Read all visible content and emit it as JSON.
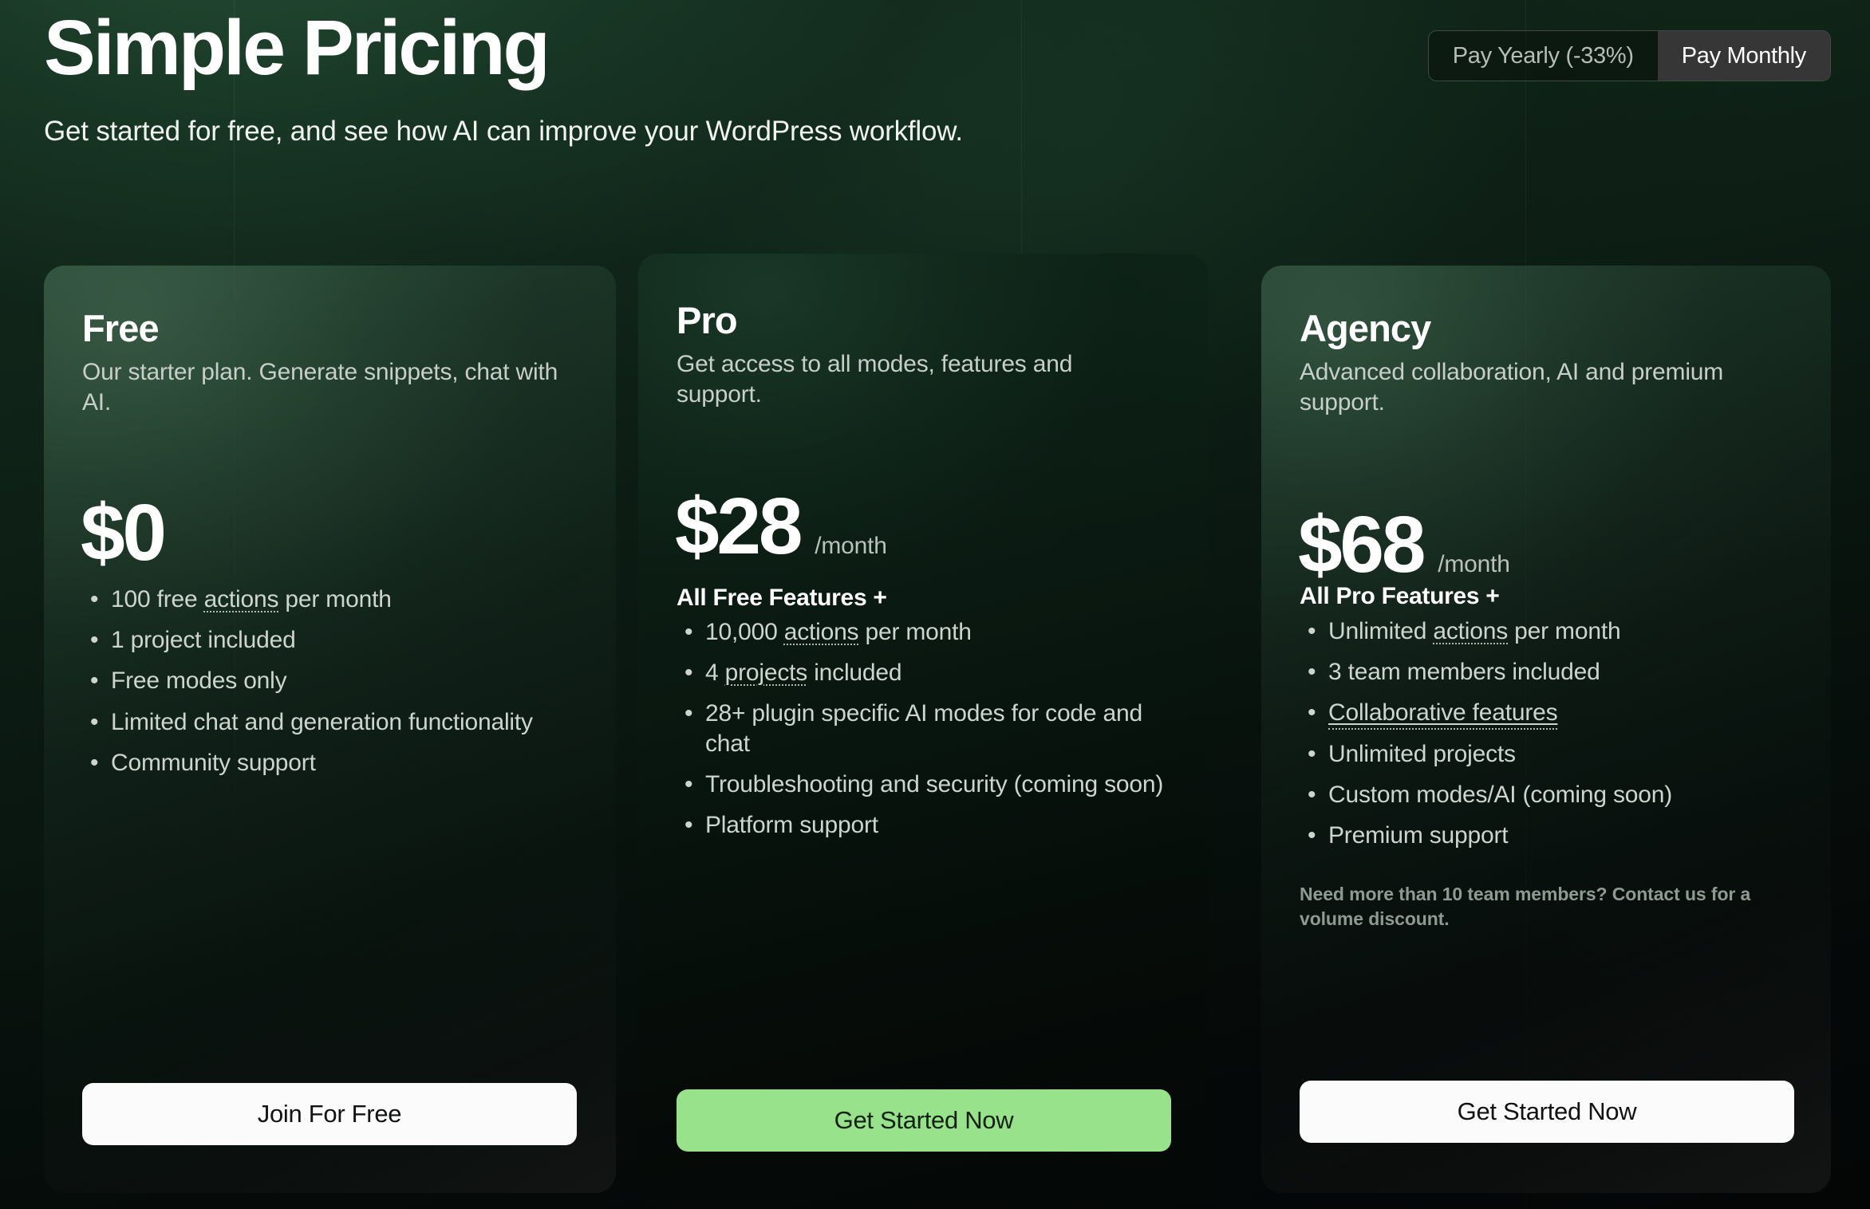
{
  "header": {
    "title": "Simple Pricing",
    "subtitle": "Get started for free, and see how AI can improve your WordPress workflow."
  },
  "billing_toggle": {
    "yearly_label": "Pay Yearly (-33%)",
    "monthly_label": "Pay Monthly",
    "selected": "Pay Monthly"
  },
  "plans": {
    "free": {
      "name": "Free",
      "description": "Our starter plan. Generate snippets, chat with AI.",
      "price": "$0",
      "period": "",
      "features_heading": "",
      "features": [
        {
          "prefix": "100 free ",
          "abbr": "actions",
          "suffix": " per month"
        },
        {
          "prefix": "1 project included",
          "abbr": "",
          "suffix": ""
        },
        {
          "prefix": "Free modes only",
          "abbr": "",
          "suffix": ""
        },
        {
          "prefix": "Limited chat and generation functionality",
          "abbr": "",
          "suffix": ""
        },
        {
          "prefix": "Community support",
          "abbr": "",
          "suffix": ""
        }
      ],
      "note": "",
      "cta_label": "Join For Free"
    },
    "pro": {
      "name": "Pro",
      "description": "Get access to all modes, features and support.",
      "price": "$28",
      "period": "/month",
      "features_heading": "All Free Features +",
      "features": [
        {
          "prefix": "10,000 ",
          "abbr": "actions",
          "suffix": " per month"
        },
        {
          "prefix": "4 ",
          "abbr": "projects",
          "suffix": " included"
        },
        {
          "prefix": "28+ plugin specific AI modes for code and chat",
          "abbr": "",
          "suffix": ""
        },
        {
          "prefix": "Troubleshooting and security (coming soon)",
          "abbr": "",
          "suffix": ""
        },
        {
          "prefix": "Platform support",
          "abbr": "",
          "suffix": ""
        }
      ],
      "note": "",
      "cta_label": "Get Started Now"
    },
    "agency": {
      "name": "Agency",
      "description": "Advanced collaboration, AI and premium support.",
      "price": "$68",
      "period": "/month",
      "features_heading": "All Pro Features +",
      "features": [
        {
          "prefix": "Unlimited ",
          "abbr": "actions",
          "suffix": " per month"
        },
        {
          "prefix": "3 team members included",
          "abbr": "",
          "suffix": ""
        },
        {
          "prefix": "",
          "link": "Collaborative features",
          "abbr": "",
          "suffix": ""
        },
        {
          "prefix": "Unlimited projects",
          "abbr": "",
          "suffix": ""
        },
        {
          "prefix": "Custom modes/AI (coming soon)",
          "abbr": "",
          "suffix": ""
        },
        {
          "prefix": "Premium support",
          "abbr": "",
          "suffix": ""
        }
      ],
      "note": "Need more than 10 team members? Contact us for a volume discount.",
      "cta_label": "Get Started Now"
    }
  },
  "colors": {
    "accent_green": "#97e28b",
    "cta_light": "#fbfbfb",
    "toggle_active_bg": "#363636",
    "text_primary": "#ffffff",
    "text_muted": "#c6cfc8"
  }
}
